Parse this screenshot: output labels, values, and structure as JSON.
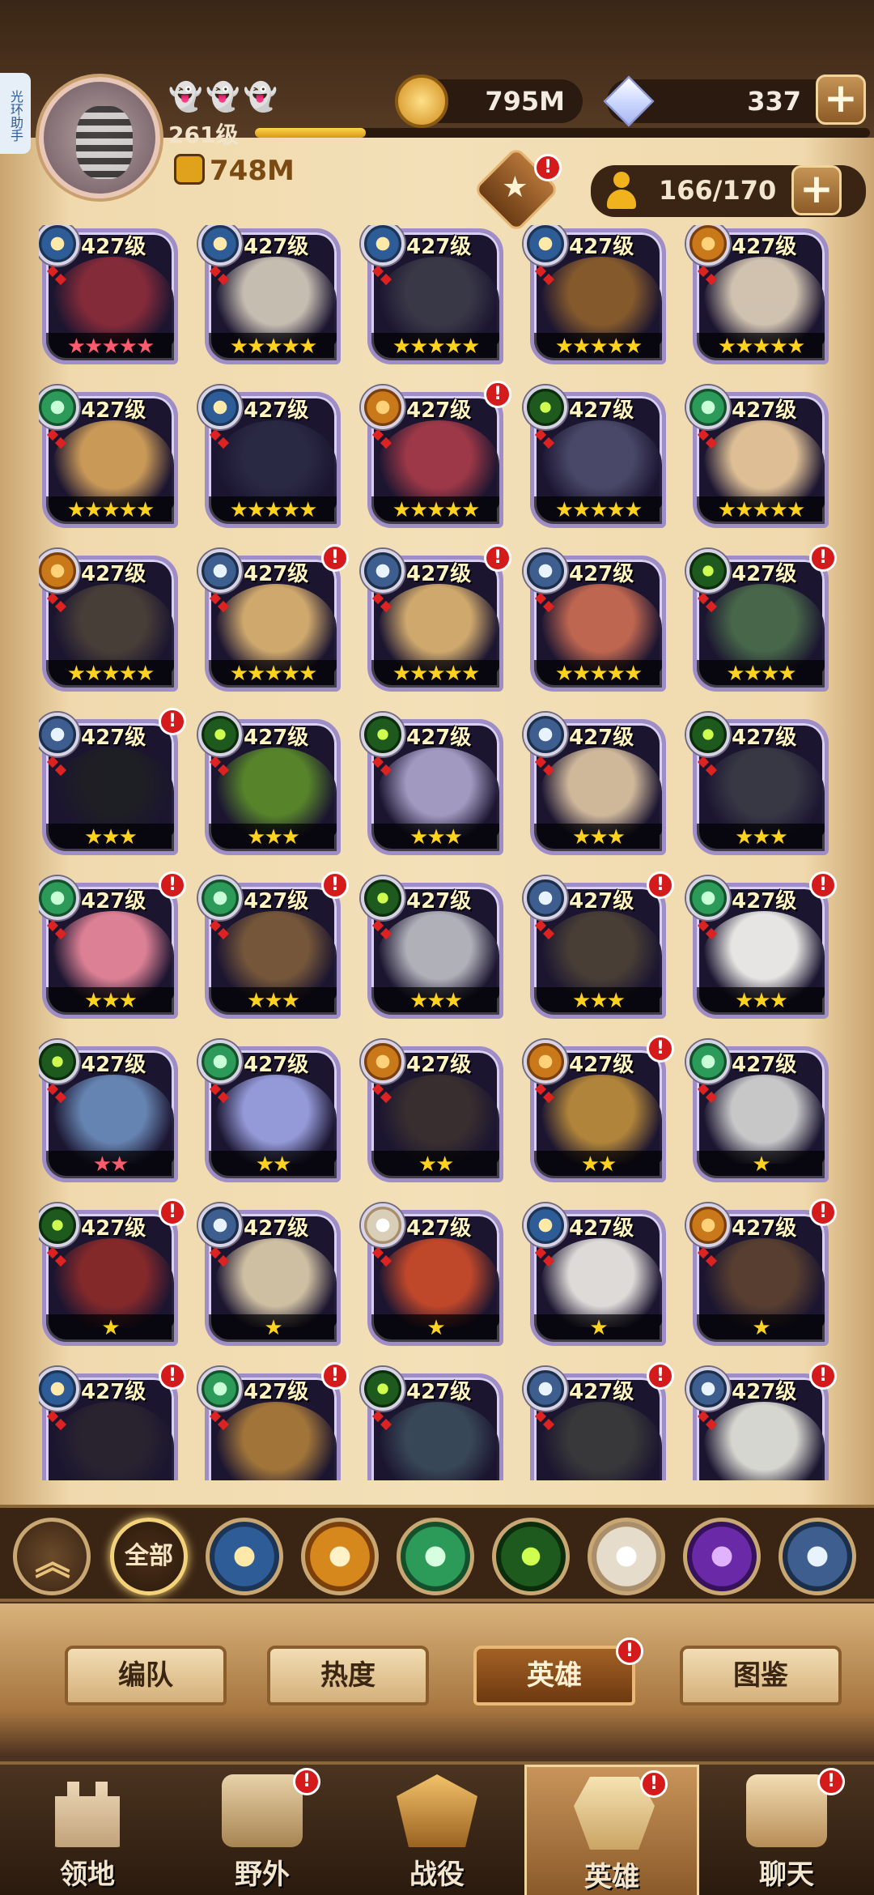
{
  "helper": {
    "label": "光环助手"
  },
  "player": {
    "level": "261级",
    "power": "748M",
    "xp_progress": 0.18
  },
  "resources": {
    "gold": "795M",
    "diamonds": "337"
  },
  "hero_count": "166/170",
  "heroes": [
    {
      "faction": "lightbearer",
      "level": "427级",
      "stars": "★★★★★",
      "star_color": "red",
      "alert": false
    },
    {
      "faction": "lightbearer",
      "level": "427级",
      "stars": "★★★★★",
      "star_color": "gold",
      "alert": false
    },
    {
      "faction": "lightbearer",
      "level": "427级",
      "stars": "★★★★★",
      "star_color": "gold",
      "alert": false
    },
    {
      "faction": "lightbearer",
      "level": "427级",
      "stars": "★★★★★",
      "star_color": "gold",
      "alert": false
    },
    {
      "faction": "mauler",
      "level": "427级",
      "stars": "★★★★★",
      "star_color": "gold",
      "alert": false
    },
    {
      "faction": "wilder",
      "level": "427级",
      "stars": "★★★★★",
      "star_color": "gold",
      "alert": false
    },
    {
      "faction": "lightbearer",
      "level": "427级",
      "stars": "★★★★★",
      "star_color": "gold",
      "alert": false
    },
    {
      "faction": "mauler",
      "level": "427级",
      "stars": "★★★★★",
      "star_color": "gold",
      "alert": true
    },
    {
      "faction": "graveborn",
      "level": "427级",
      "stars": "★★★★★",
      "star_color": "gold",
      "alert": false
    },
    {
      "faction": "wilder",
      "level": "427级",
      "stars": "★★★★★",
      "star_color": "gold",
      "alert": false
    },
    {
      "faction": "mauler",
      "level": "427级",
      "stars": "★★★★★",
      "star_color": "gold",
      "alert": false
    },
    {
      "faction": "dimensional",
      "level": "427级",
      "stars": "★★★★★",
      "star_color": "gold",
      "alert": true
    },
    {
      "faction": "dimensional",
      "level": "427级",
      "stars": "★★★★★",
      "star_color": "gold",
      "alert": true
    },
    {
      "faction": "dimensional",
      "level": "427级",
      "stars": "★★★★★",
      "star_color": "gold",
      "alert": false
    },
    {
      "faction": "graveborn",
      "level": "427级",
      "stars": "★★★★",
      "star_color": "gold",
      "alert": true
    },
    {
      "faction": "dimensional",
      "level": "427级",
      "stars": "★★★",
      "star_color": "gold",
      "alert": true
    },
    {
      "faction": "graveborn",
      "level": "427级",
      "stars": "★★★",
      "star_color": "gold",
      "alert": false
    },
    {
      "faction": "graveborn",
      "level": "427级",
      "stars": "★★★",
      "star_color": "gold",
      "alert": false
    },
    {
      "faction": "dimensional",
      "level": "427级",
      "stars": "★★★",
      "star_color": "gold",
      "alert": false
    },
    {
      "faction": "graveborn",
      "level": "427级",
      "stars": "★★★",
      "star_color": "gold",
      "alert": false
    },
    {
      "faction": "wilder",
      "level": "427级",
      "stars": "★★★",
      "star_color": "gold",
      "alert": true
    },
    {
      "faction": "wilder",
      "level": "427级",
      "stars": "★★★",
      "star_color": "gold",
      "alert": true
    },
    {
      "faction": "graveborn",
      "level": "427级",
      "stars": "★★★",
      "star_color": "gold",
      "alert": false
    },
    {
      "faction": "dimensional",
      "level": "427级",
      "stars": "★★★",
      "star_color": "gold",
      "alert": true
    },
    {
      "faction": "wilder",
      "level": "427级",
      "stars": "★★★",
      "star_color": "gold",
      "alert": true
    },
    {
      "faction": "graveborn",
      "level": "427级",
      "stars": "★★",
      "star_color": "red",
      "alert": false
    },
    {
      "faction": "wilder",
      "level": "427级",
      "stars": "★★",
      "star_color": "gold",
      "alert": false
    },
    {
      "faction": "mauler",
      "level": "427级",
      "stars": "★★",
      "star_color": "gold",
      "alert": false
    },
    {
      "faction": "mauler",
      "level": "427级",
      "stars": "★★",
      "star_color": "gold",
      "alert": true
    },
    {
      "faction": "wilder",
      "level": "427级",
      "stars": "★",
      "star_color": "gold",
      "alert": false
    },
    {
      "faction": "graveborn",
      "level": "427级",
      "stars": "★",
      "star_color": "gold",
      "alert": true
    },
    {
      "faction": "dimensional",
      "level": "427级",
      "stars": "★",
      "star_color": "gold",
      "alert": false
    },
    {
      "faction": "celestial",
      "level": "427级",
      "stars": "★",
      "star_color": "gold",
      "alert": false
    },
    {
      "faction": "lightbearer",
      "level": "427级",
      "stars": "★",
      "star_color": "gold",
      "alert": false
    },
    {
      "faction": "mauler",
      "level": "427级",
      "stars": "★",
      "star_color": "gold",
      "alert": true
    },
    {
      "faction": "lightbearer",
      "level": "427级",
      "stars": "",
      "star_color": "gold",
      "alert": true
    },
    {
      "faction": "wilder",
      "level": "427级",
      "stars": "",
      "star_color": "gold",
      "alert": true
    },
    {
      "faction": "graveborn",
      "level": "427级",
      "stars": "",
      "star_color": "gold",
      "alert": false
    },
    {
      "faction": "dimensional",
      "level": "427级",
      "stars": "",
      "star_color": "gold",
      "alert": true
    },
    {
      "faction": "dimensional",
      "level": "427级",
      "stars": "",
      "star_color": "gold",
      "alert": true
    }
  ],
  "faction_filters": [
    {
      "name": "all",
      "label": "全部"
    },
    {
      "name": "lightbearer"
    },
    {
      "name": "mauler"
    },
    {
      "name": "wilder"
    },
    {
      "name": "graveborn"
    },
    {
      "name": "celestial"
    },
    {
      "name": "hypogean"
    },
    {
      "name": "dimensional"
    }
  ],
  "subtabs": [
    {
      "label": "编队",
      "active": false,
      "alert": false
    },
    {
      "label": "热度",
      "active": false,
      "alert": false
    },
    {
      "label": "英雄",
      "active": true,
      "alert": true
    },
    {
      "label": "图鉴",
      "active": false,
      "alert": false
    }
  ],
  "nav": [
    {
      "label": "领地",
      "icon": "castle-icon",
      "alert": false,
      "active": false
    },
    {
      "label": "野外",
      "icon": "scroll-map-icon",
      "alert": true,
      "active": false
    },
    {
      "label": "战役",
      "icon": "battle-shield-icon",
      "alert": false,
      "active": false
    },
    {
      "label": "英雄",
      "icon": "hero-helmet-icon",
      "alert": true,
      "active": true
    },
    {
      "label": "聊天",
      "icon": "chat-bubble-icon",
      "alert": true,
      "active": false
    }
  ],
  "alert_mark": "!"
}
